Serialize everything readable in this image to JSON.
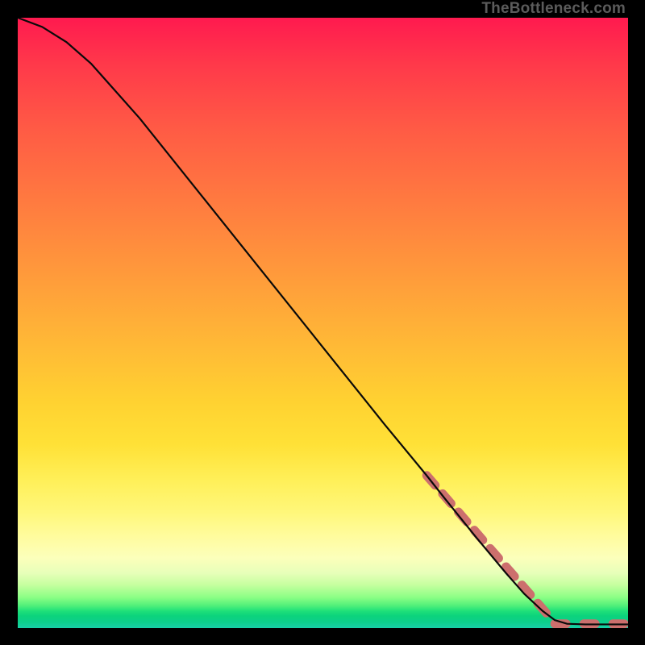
{
  "watermark": "TheBottleneck.com",
  "chart_data": {
    "type": "line",
    "title": "",
    "xlabel": "",
    "ylabel": "",
    "xlim": [
      0,
      100
    ],
    "ylim": [
      0,
      100
    ],
    "grid": false,
    "curve": [
      {
        "x": 0,
        "y": 100
      },
      {
        "x": 4,
        "y": 98.5
      },
      {
        "x": 8,
        "y": 96.0
      },
      {
        "x": 12,
        "y": 92.5
      },
      {
        "x": 20,
        "y": 83.5
      },
      {
        "x": 30,
        "y": 71.0
      },
      {
        "x": 40,
        "y": 58.5
      },
      {
        "x": 50,
        "y": 46.0
      },
      {
        "x": 60,
        "y": 33.5
      },
      {
        "x": 67,
        "y": 25.0
      },
      {
        "x": 70,
        "y": 21.2
      },
      {
        "x": 75,
        "y": 15.0
      },
      {
        "x": 80,
        "y": 9.0
      },
      {
        "x": 83,
        "y": 5.6
      },
      {
        "x": 86,
        "y": 2.8
      },
      {
        "x": 88,
        "y": 1.3
      },
      {
        "x": 90,
        "y": 0.7
      },
      {
        "x": 93,
        "y": 0.6
      },
      {
        "x": 96,
        "y": 0.6
      },
      {
        "x": 100,
        "y": 0.6
      }
    ],
    "dashed_segments": [
      {
        "from": {
          "x": 67,
          "y": 25.0
        },
        "to": {
          "x": 87,
          "y": 2.0
        }
      },
      {
        "from": {
          "x": 88,
          "y": 0.7
        },
        "to": {
          "x": 100,
          "y": 0.7
        }
      }
    ],
    "dash_color": "#cc6f6d",
    "dash_width": 11,
    "line_color": "#0a0a0a",
    "line_width": 2.2
  }
}
